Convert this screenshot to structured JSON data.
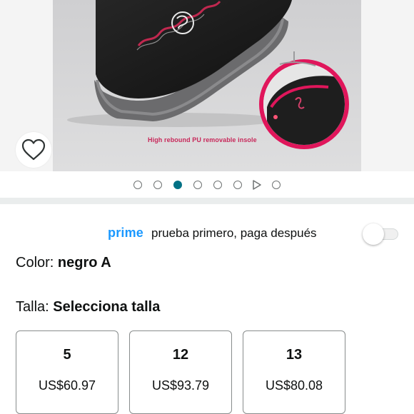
{
  "image": {
    "caption": "High rebound PU removable insole",
    "carousel": {
      "dots": [
        {
          "type": "image",
          "active": false
        },
        {
          "type": "image",
          "active": false
        },
        {
          "type": "image",
          "active": true
        },
        {
          "type": "image",
          "active": false
        },
        {
          "type": "image",
          "active": false
        },
        {
          "type": "image",
          "active": false
        },
        {
          "type": "video",
          "active": false
        },
        {
          "type": "image",
          "active": false
        }
      ]
    },
    "wishlist_icon": "heart-icon"
  },
  "prime": {
    "logo": "prime",
    "text": "prueba primero, paga después",
    "toggle_on": false
  },
  "color": {
    "label": "Color: ",
    "value": "negro A"
  },
  "size": {
    "label": "Talla: ",
    "value": "Selecciona talla",
    "options": [
      {
        "size": "5",
        "price": "US$60.97"
      },
      {
        "size": "12",
        "price": "US$93.79"
      },
      {
        "size": "13",
        "price": "US$80.08"
      }
    ]
  },
  "colors": {
    "accent": "#007185",
    "prime_blue": "#1a98ff",
    "insole_pink": "#e0165b",
    "caption_pink": "#c8285a"
  }
}
